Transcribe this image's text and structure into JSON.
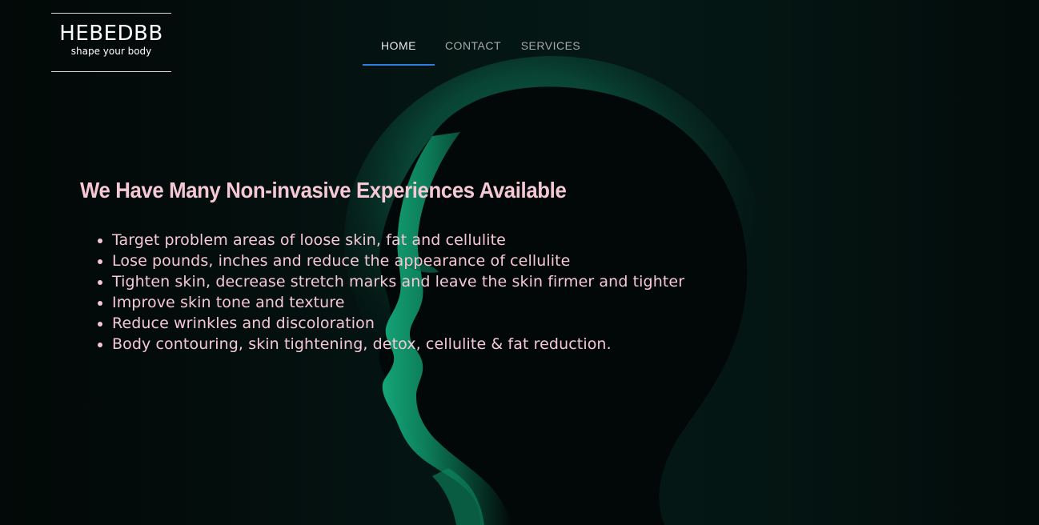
{
  "brand": {
    "name": "HEBEDBB",
    "tagline": "shape your body"
  },
  "nav": {
    "items": [
      {
        "label": "HOME",
        "active": true
      },
      {
        "label": "CONTACT",
        "active": false
      },
      {
        "label": "SERVICES",
        "active": false
      }
    ]
  },
  "hero": {
    "headline": "We Have Many Non-invasive Experiences Available",
    "benefits": [
      "Target problem areas of loose skin, fat and cellulite",
      "Lose pounds, inches and reduce the appearance of cellulite",
      "Tighten skin, decrease stretch marks and leave the skin firmer and tighter",
      "Improve skin tone and texture",
      "Reduce wrinkles and discoloration",
      "Body contouring, skin tightening, detox, cellulite & fat reduction."
    ],
    "background_image": "face-green-light-icon"
  },
  "colors": {
    "headline": "#f6c8d5",
    "nav_active_underline": "#2f7de1",
    "background": "#020807",
    "face_glow": "#12a070"
  }
}
